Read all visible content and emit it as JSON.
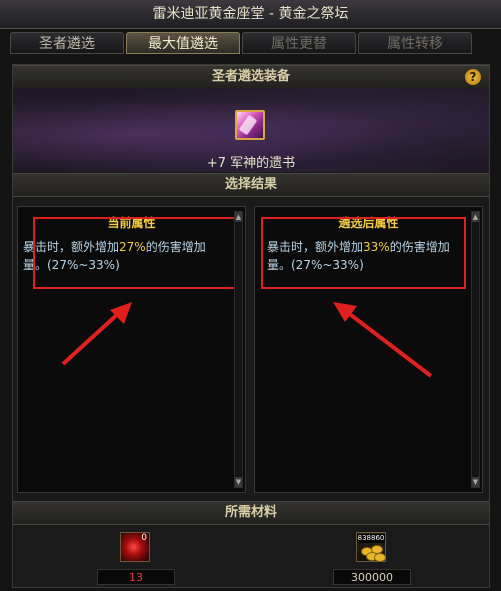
{
  "window": {
    "title": "雷米迪亚黄金座堂 - 黄金之祭坛"
  },
  "tabs": [
    {
      "label": "圣者遴选",
      "state": "normal"
    },
    {
      "label": "最大值遴选",
      "state": "active"
    },
    {
      "label": "属性更替",
      "state": "disabled"
    },
    {
      "label": "属性转移",
      "state": "disabled"
    }
  ],
  "equipment_section": {
    "header": "圣者遴选装备",
    "help_icon": "?",
    "item_name": "+7 军神的遗书"
  },
  "result_section": {
    "header": "选择结果",
    "current": {
      "title": "当前属性",
      "text_before": "暴击时，额外增加",
      "value": "27%",
      "text_after": "的伤害增加量。(27%~33%)"
    },
    "after": {
      "title": "遴选后属性",
      "text_before": "暴击时，额外增加",
      "value": "33%",
      "text_after": "的伤害增加量。(27%~33%)"
    }
  },
  "materials_section": {
    "header": "所需材料",
    "items": [
      {
        "icon": "red-stone-icon",
        "badge": "0",
        "value": "13",
        "value_color": "#e04040"
      },
      {
        "icon": "gold-coins-icon",
        "badge": "838860",
        "value": "300000",
        "value_color": "#d8d0b8"
      }
    ]
  },
  "annotation": {
    "highlight_color": "#e0201e"
  }
}
